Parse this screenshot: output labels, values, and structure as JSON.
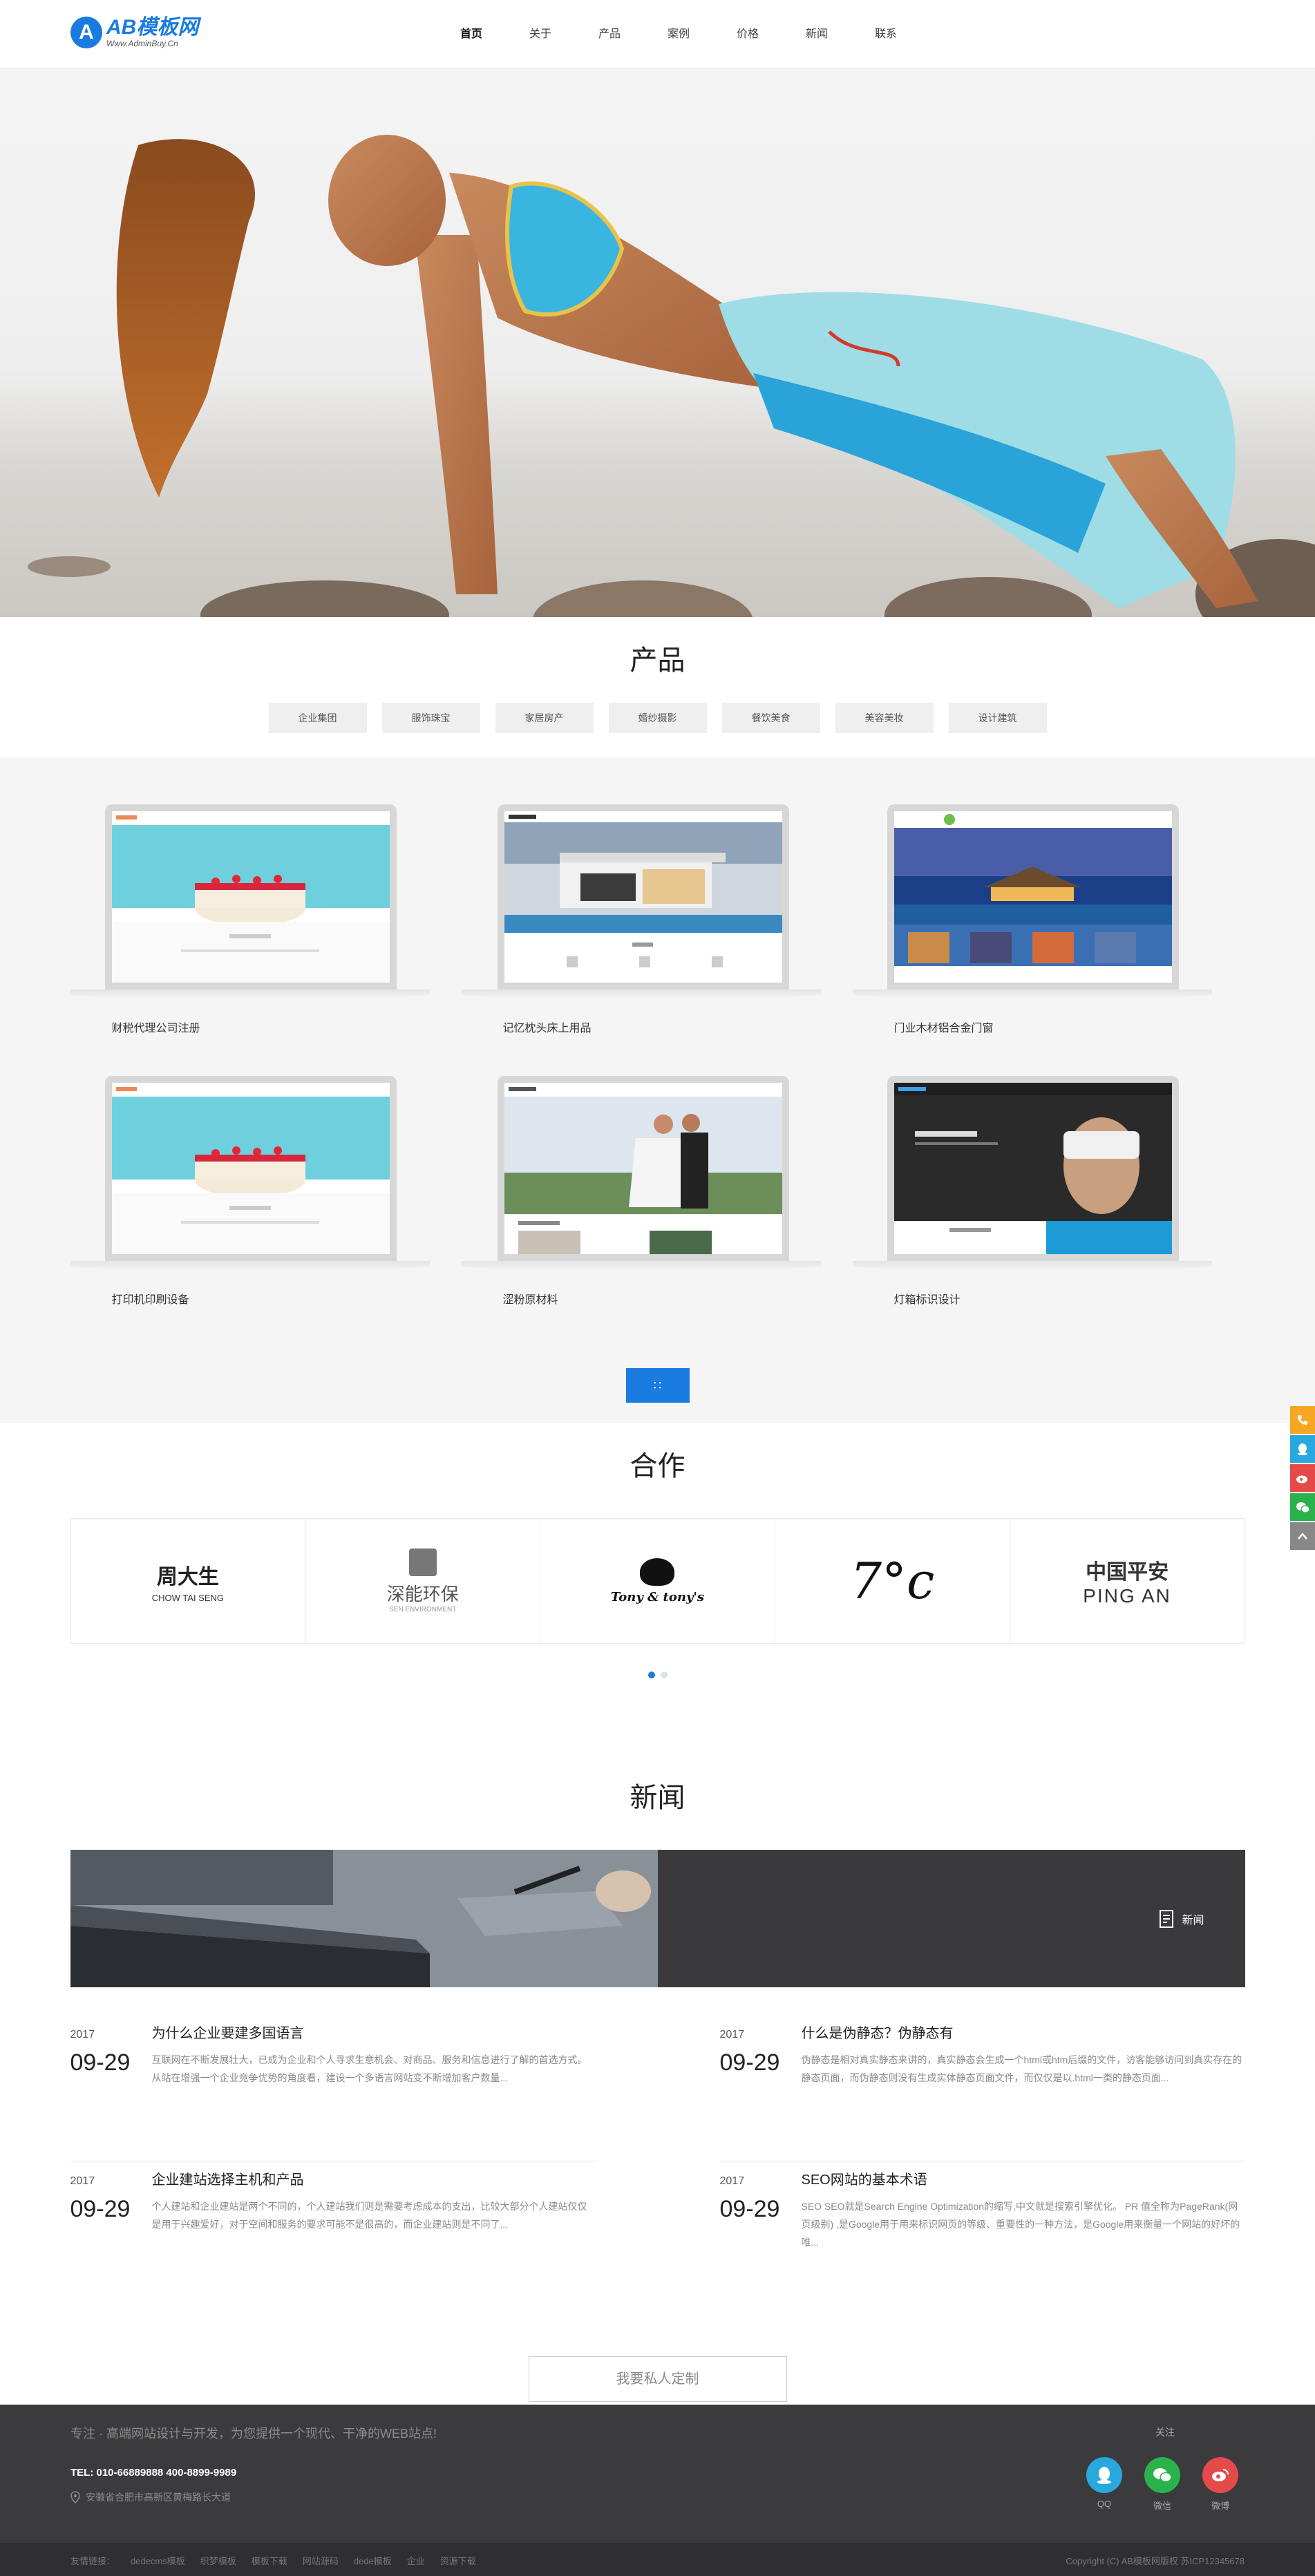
{
  "header": {
    "logo_mark": "A",
    "logo_title": "AB模板网",
    "logo_sub": "Www.AdminBuy.Cn",
    "nav": [
      "首页",
      "关于",
      "产品",
      "案例",
      "价格",
      "新闻",
      "联系"
    ]
  },
  "products": {
    "title": "产品",
    "tabs": [
      "企业集团",
      "服饰珠宝",
      "家居房产",
      "婚纱摄影",
      "餐饮美食",
      "美容美妆",
      "设计建筑"
    ],
    "items": [
      {
        "label": "财税代理公司注册",
        "theme": "cake"
      },
      {
        "label": "记忆枕头床上用品",
        "theme": "house"
      },
      {
        "label": "门业木材铝合金门窗",
        "theme": "travel"
      },
      {
        "label": "打印机印刷设备",
        "theme": "cake"
      },
      {
        "label": "涩粉原材料",
        "theme": "wedding"
      },
      {
        "label": "灯箱标识设计",
        "theme": "vr"
      }
    ],
    "more_icon": "grid-icon"
  },
  "partners": {
    "title": "合作",
    "logos": [
      {
        "name": "周大生",
        "sub": "CHOW TAI SENG"
      },
      {
        "name": "深能环保",
        "sub": "SEN ENVIRONMENT"
      },
      {
        "name": "Tony & tony's",
        "sub": ""
      },
      {
        "name": "7°c",
        "sub": ""
      },
      {
        "name": "中国平安",
        "sub": "PING AN"
      }
    ]
  },
  "news": {
    "title": "新闻",
    "banner_label": "新闻",
    "items": [
      {
        "year": "2017",
        "date": "09-29",
        "title": "为什么企业要建多国语言",
        "desc": "互联网在不断发展壮大，已成为企业和个人寻求生意机会、对商品、服务和信息进行了解的首选方式。从站在增强一个企业竞争优势的角度看，建设一个多语言网站变不断增加客户数量..."
      },
      {
        "year": "2017",
        "date": "09-29",
        "title": "什么是伪静态？伪静态有",
        "desc": "伪静态是相对真实静态来讲的，真实静态会生成一个html或htm后缀的文件，访客能够访问到真实存在的静态页面，而伪静态则没有生成实体静态页面文件，而仅仅是以.html一类的静态页面..."
      },
      {
        "year": "2017",
        "date": "09-29",
        "title": "企业建站选择主机和产品",
        "desc": "个人建站和企业建站是两个不同的，个人建站我们则是需要考虑成本的支出，比较大部分个人建站仅仅是用于兴趣爱好，对于空间和服务的要求可能不是很高的，而企业建站则是不同了..."
      },
      {
        "year": "2017",
        "date": "09-29",
        "title": "SEO网站的基本术语",
        "desc": "SEO SEO就是Search Engine Optimization的缩写,中文就是搜索引擎优化。 PR 值全称为PageRank(网页级别) ,是Google用于用来标识网页的等级、重要性的一种方法，是Google用来衡量一个网站的好坏的唯..."
      }
    ],
    "custom_button": "我要私人定制"
  },
  "footer": {
    "slogan": "专注 · 高端网站设计与开发，为您提供一个现代、干净的WEB站点!",
    "tel": "TEL: 010-66889888 400-8899-9989",
    "address": "安徽省合肥市高新区黄梅路长大道",
    "follow": "关注",
    "social": [
      {
        "label": "QQ",
        "color": "#29a8e0",
        "icon": "qq-icon"
      },
      {
        "label": "微信",
        "color": "#2ab24c",
        "icon": "wechat-icon"
      },
      {
        "label": "微博",
        "color": "#e44a4a",
        "icon": "weibo-icon"
      }
    ],
    "links": [
      "友情链接：",
      "dedecms模板",
      "织梦模板",
      "模板下载",
      "网站源码",
      "dede模板",
      "企业",
      "资源下载"
    ],
    "copyright": "Copyright (C) AB模板网版权 苏ICP12345678"
  },
  "sidebar": [
    {
      "icon": "phone-icon",
      "color": "#f5a623"
    },
    {
      "icon": "qq-icon",
      "color": "#29a8e0"
    },
    {
      "icon": "weibo-icon",
      "color": "#e44a4a"
    },
    {
      "icon": "wechat-icon",
      "color": "#2ab24c"
    },
    {
      "icon": "top-icon",
      "color": "#888888"
    }
  ]
}
